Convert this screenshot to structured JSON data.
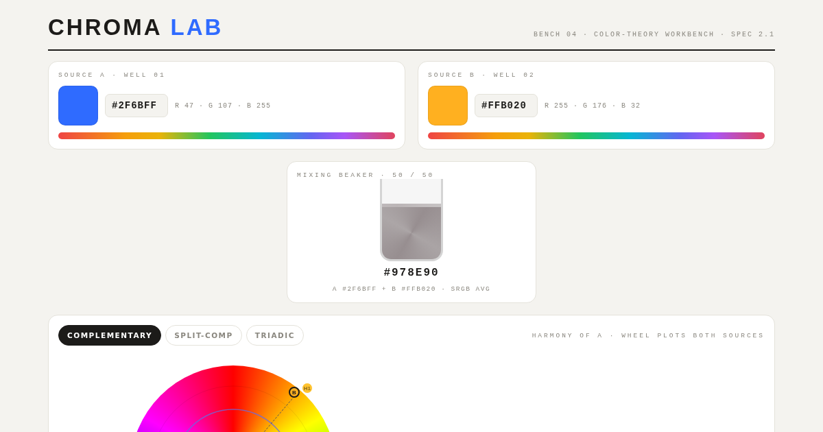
{
  "header": {
    "title": "CHROMA",
    "title_accent": "LAB",
    "subtitle": "BENCH 04 · COLOR-THEORY WORKBENCH · SPEC 2.1"
  },
  "sources": [
    {
      "label": "SOURCE A · WELL 01",
      "color": "#2F6BFF",
      "hex": "#2F6BFF",
      "rgb": "R 47 · G 107 · B 255"
    },
    {
      "label": "SOURCE B · WELL 02",
      "color": "#FFB020",
      "hex": "#FFB020",
      "rgb": "R 255 · G 176 · B 32"
    }
  ],
  "beaker": {
    "label": "MIXING BEAKER · 50 / 50",
    "color": "#978E90",
    "level": 0.65,
    "hex": "#978E90",
    "formula": "A #2F6BFF + B #FFB020 · SRGB AVG"
  },
  "harmony": {
    "tabs": [
      {
        "label": "COMPLEMENTARY",
        "selected": true
      },
      {
        "label": "SPLIT-COMP",
        "selected": false
      },
      {
        "label": "TRIADIC",
        "selected": false
      }
    ],
    "note": "HARMONY OF A · WHEEL PLOTS BOTH SOURCES",
    "markers": [
      {
        "label": "H1",
        "color": "#FFC32F"
      },
      {
        "label": "B",
        "color": "#FFB020"
      }
    ]
  }
}
